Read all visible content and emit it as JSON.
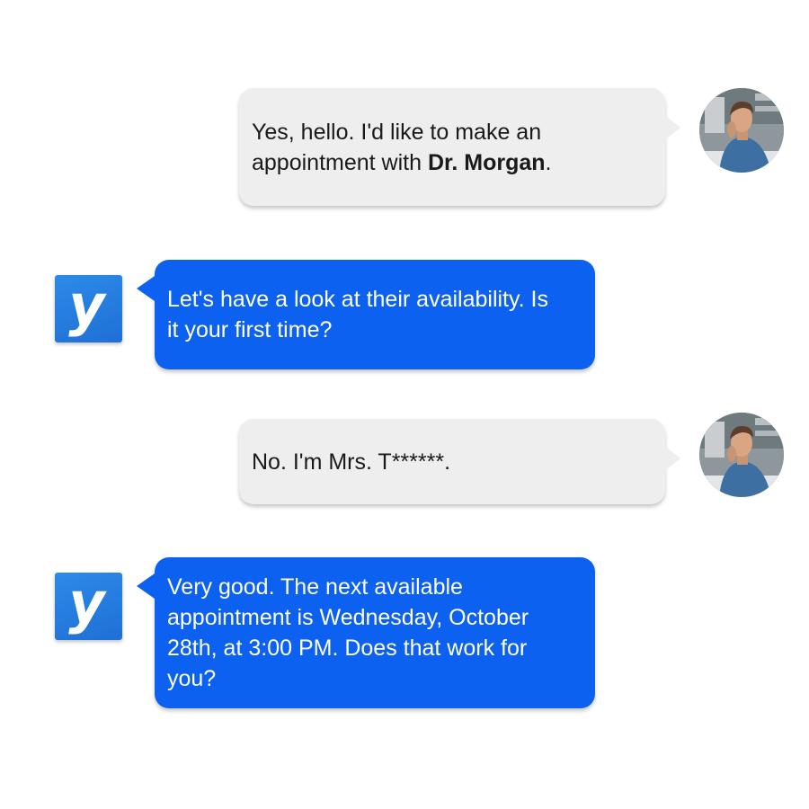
{
  "conversation": {
    "messages": [
      {
        "sender": "user",
        "line1": "Yes, hello. I'd like to make an",
        "line2_prefix": "appointment with ",
        "line2_bold": "Dr. Morgan",
        "line2_suffix": "."
      },
      {
        "sender": "assistant",
        "line1": "Let's have a look at their availability. Is",
        "line2": "it your first time?"
      },
      {
        "sender": "user",
        "line1": "No. I'm Mrs. T******."
      },
      {
        "sender": "assistant",
        "line1": "Very good. The next available",
        "line2": "appointment is Wednesday, October",
        "line3": "28th, at 3:00 PM. Does that work for",
        "line4": "you?"
      }
    ],
    "bot_logo_letter": "y",
    "colors": {
      "user_bubble": "#eeeeee",
      "bot_bubble": "#0d61f0",
      "bot_logo": "#2180e6"
    },
    "icons": {
      "user_avatar": "user-photo-avatar",
      "bot_avatar": "y-logo-icon"
    }
  }
}
